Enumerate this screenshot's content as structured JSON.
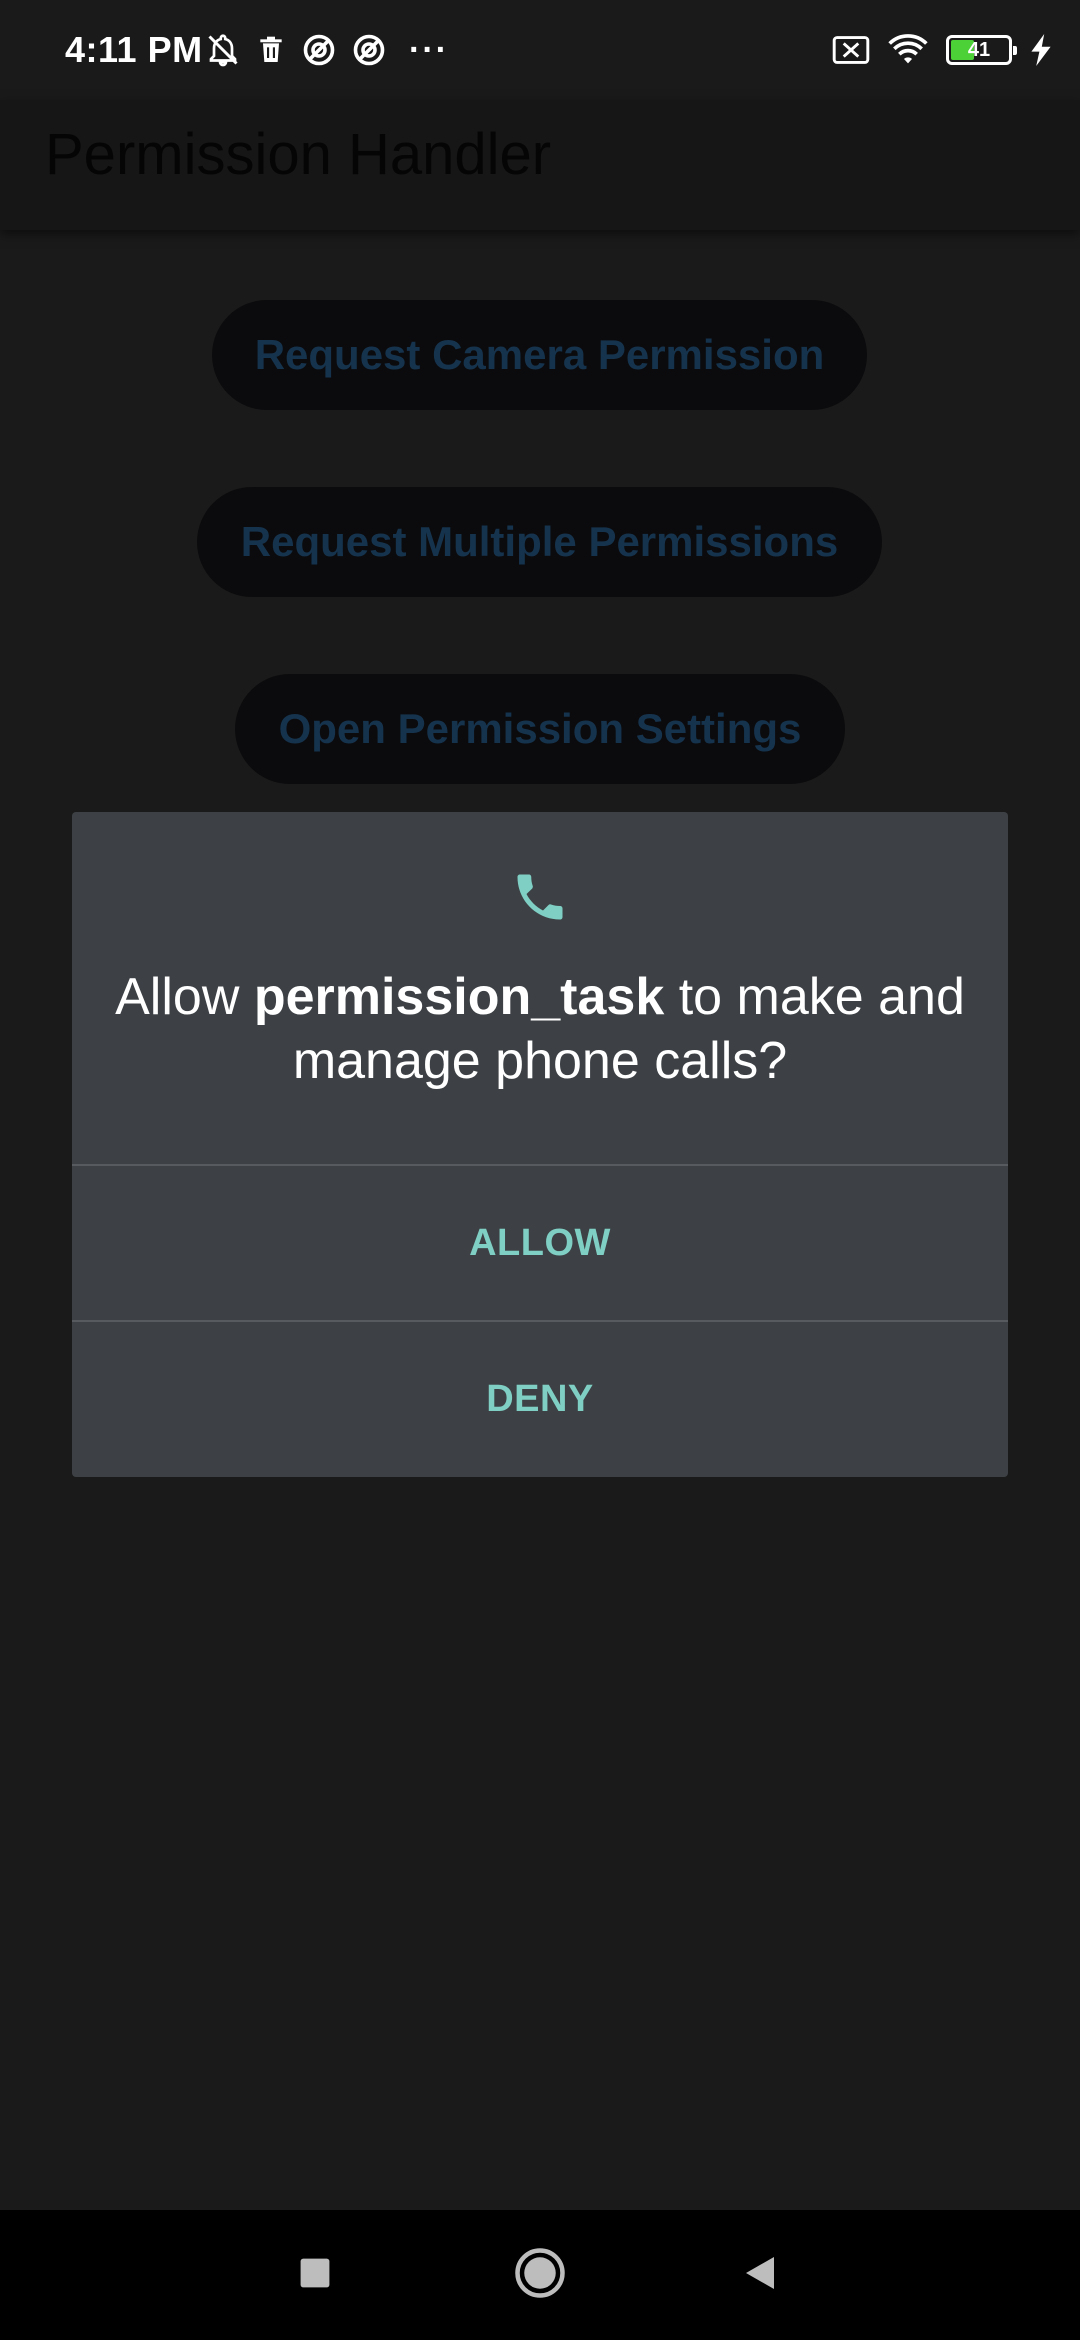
{
  "status_bar": {
    "time": "4:11 PM",
    "more_indicator": "···",
    "battery_level": "41",
    "battery_fraction": 0.41,
    "icons_left": [
      "notifications-muted-icon",
      "trash-icon",
      "data-saver-icon",
      "data-saver-icon",
      "more-icon"
    ],
    "icons_right": [
      "no-sim-icon",
      "wifi-icon",
      "battery-icon",
      "charging-icon"
    ]
  },
  "app_bar": {
    "title": "Permission Handler"
  },
  "buttons": {
    "camera": "Request Camera Permission",
    "multiple": "Request Multiple Permissions",
    "settings": "Open Permission Settings"
  },
  "dialog": {
    "icon": "phone-icon",
    "message_prefix": "Allow ",
    "app_name": "permission_task",
    "message_suffix": " to make and manage phone calls?",
    "allow_label": "ALLOW",
    "deny_label": "DENY",
    "accent_color": "#7fcfc4",
    "background_color": "#3d4145"
  },
  "nav_bar": {
    "icons": [
      "recents-icon",
      "home-icon",
      "back-icon"
    ]
  }
}
